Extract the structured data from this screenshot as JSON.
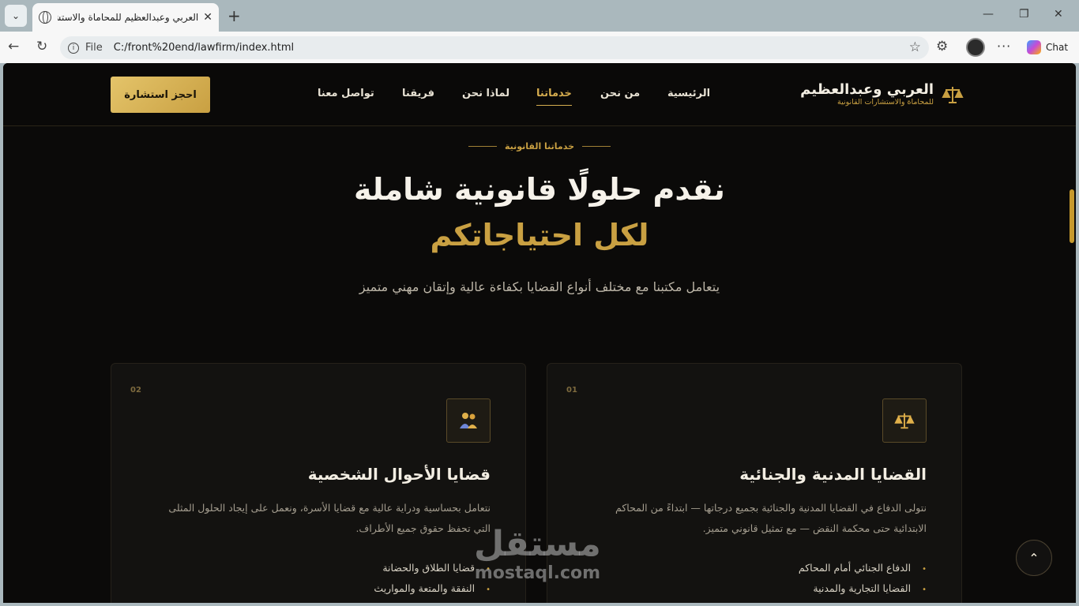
{
  "browser": {
    "tab_title": "العربي وعبدالعظيم للمحاماة والاستشارات القانونية",
    "file_label": "File",
    "url": "C:/front%20end/lawfirm/index.html",
    "chat_label": "Chat"
  },
  "header": {
    "cta_label": "احجز استشارة",
    "nav": [
      "تواصل معنا",
      "فريقنا",
      "لماذا نحن",
      "خدماتنا",
      "من نحن",
      "الرئيسية"
    ],
    "active_nav": "خدماتنا",
    "brand_name": "العربي وعبدالعظيم",
    "brand_sub": "للمحاماة والاستشارات القانونية"
  },
  "hero": {
    "eyebrow": "خدماتنا القانونية",
    "title_line1": "نقدم حلولًا قانونية شاملة",
    "title_line2": "لكل احتياجاتكم",
    "lead": "يتعامل مكتبنا مع مختلف أنواع القضايا بكفاءة عالية وإتقان مهني متميز"
  },
  "cards": [
    {
      "num": "01",
      "icon": "scales-icon",
      "title": "القضايا المدنية والجنائية",
      "desc": "نتولى الدفاع في القضايا المدنية والجنائية بجميع درجاتها — ابتداءً من المحاكم الابتدائية حتى محكمة النقض — مع تمثيل قانوني متميز.",
      "items": [
        "الدفاع الجنائي أمام المحاكم",
        "القضايا التجارية والمدنية"
      ]
    },
    {
      "num": "02",
      "icon": "family-icon",
      "title": "قضايا الأحوال الشخصية",
      "desc": "نتعامل بحساسية ودراية عالية مع قضايا الأسرة، ونعمل على إيجاد الحلول المثلى التي تحفظ حقوق جميع الأطراف.",
      "items": [
        "قضايا الطلاق والحضانة",
        "النفقة والمتعة والمواريث"
      ]
    }
  ],
  "watermark": {
    "line1": "مستقل",
    "line2": "mostaql.com"
  },
  "colors": {
    "gold": "#c9a042",
    "background": "#0b0a09",
    "card": "#131210"
  }
}
